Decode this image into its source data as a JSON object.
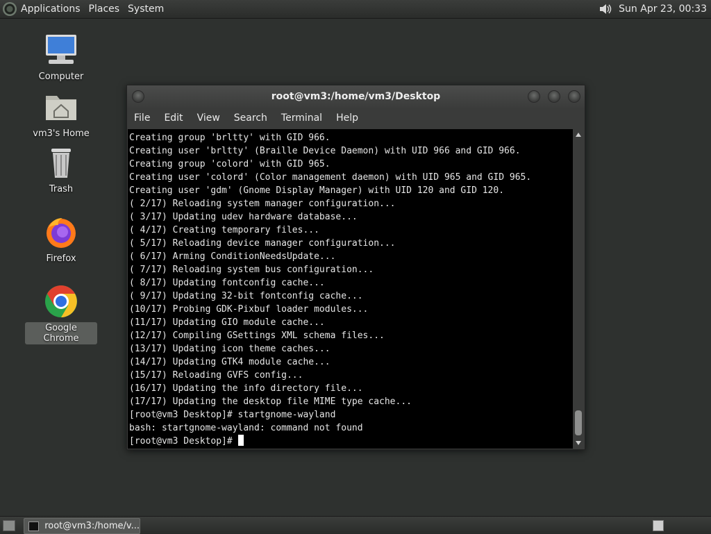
{
  "top_panel": {
    "menus": [
      "Applications",
      "Places",
      "System"
    ],
    "clock": "Sun Apr 23, 00:33",
    "volume_icon": "speaker-icon"
  },
  "desktop_icons": [
    {
      "label": "Computer",
      "icon": "computer-icon"
    },
    {
      "label": "vm3's Home",
      "icon": "home-folder-icon"
    },
    {
      "label": "Trash",
      "icon": "trash-icon"
    },
    {
      "label": "Firefox",
      "icon": "firefox-icon"
    },
    {
      "label": "Google Chrome",
      "icon": "chrome-icon",
      "selected": true
    }
  ],
  "terminal": {
    "title": "root@vm3:/home/vm3/Desktop",
    "menus": [
      "File",
      "Edit",
      "View",
      "Search",
      "Terminal",
      "Help"
    ],
    "lines": [
      "Creating group 'brltty' with GID 966.",
      "Creating user 'brltty' (Braille Device Daemon) with UID 966 and GID 966.",
      "Creating group 'colord' with GID 965.",
      "Creating user 'colord' (Color management daemon) with UID 965 and GID 965.",
      "Creating user 'gdm' (Gnome Display Manager) with UID 120 and GID 120.",
      "( 2/17) Reloading system manager configuration...",
      "( 3/17) Updating udev hardware database...",
      "( 4/17) Creating temporary files...",
      "( 5/17) Reloading device manager configuration...",
      "( 6/17) Arming ConditionNeedsUpdate...",
      "( 7/17) Reloading system bus configuration...",
      "( 8/17) Updating fontconfig cache...",
      "( 9/17) Updating 32-bit fontconfig cache...",
      "(10/17) Probing GDK-Pixbuf loader modules...",
      "(11/17) Updating GIO module cache...",
      "(12/17) Compiling GSettings XML schema files...",
      "(13/17) Updating icon theme caches...",
      "(14/17) Updating GTK4 module cache...",
      "(15/17) Reloading GVFS config...",
      "(16/17) Updating the info directory file...",
      "(17/17) Updating the desktop file MIME type cache...",
      "[root@vm3 Desktop]# startgnome-wayland",
      "bash: startgnome-wayland: command not found"
    ],
    "prompt": "[root@vm3 Desktop]# "
  },
  "bottom_panel": {
    "task_label": "root@vm3:/home/v..."
  }
}
